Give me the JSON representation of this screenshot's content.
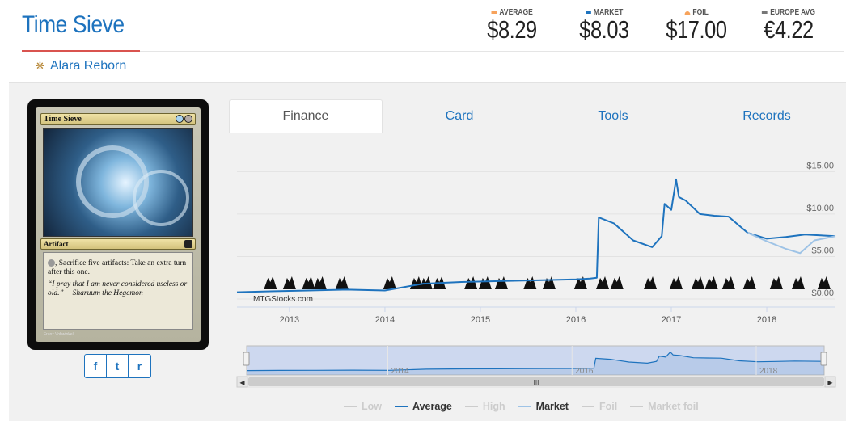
{
  "header": {
    "title": "Time Sieve",
    "set_name": "Alara Reborn"
  },
  "prices": [
    {
      "label": "AVERAGE",
      "value": "$8.29",
      "color": "#f7a35c"
    },
    {
      "label": "MARKET",
      "value": "$8.03",
      "color": "#1e73be"
    },
    {
      "label": "FOIL",
      "value": "$17.00",
      "color": "#f7a35c"
    },
    {
      "label": "EUROPE AVG",
      "value": "€4.22",
      "color": "#777777"
    }
  ],
  "card": {
    "name": "Time Sieve",
    "type_line": "Artifact",
    "rules_text": ", Sacrifice five artifacts: Take an extra turn after this one.",
    "flavor_text": "“I pray that I am never considered useless or old.” —Sharuum the Hegemon",
    "artist": "Franz Vohwinkel"
  },
  "share": {
    "facebook": "f",
    "twitter": "t",
    "reddit": "r"
  },
  "tabs": [
    {
      "label": "Finance",
      "active": true
    },
    {
      "label": "Card",
      "active": false
    },
    {
      "label": "Tools",
      "active": false
    },
    {
      "label": "Records",
      "active": false
    }
  ],
  "chart_data": {
    "type": "line",
    "credit": "MTGStocks.com",
    "y_ticks": [
      "$15.00",
      "$10.00",
      "$5.00",
      "$0.00"
    ],
    "ylim": [
      0,
      15
    ],
    "x_ticks": [
      "2013",
      "2014",
      "2015",
      "2016",
      "2017",
      "2018"
    ],
    "xlim": [
      2012.45,
      2018.72
    ],
    "grid": true,
    "series": [
      {
        "name": "Average",
        "color": "#1e73be",
        "x": [
          2012.45,
          2012.8,
          2013.2,
          2013.6,
          2014.0,
          2014.4,
          2014.8,
          2015.2,
          2015.6,
          2016.0,
          2016.15,
          2016.22,
          2016.24,
          2016.4,
          2016.6,
          2016.8,
          2016.9,
          2016.93,
          2017.0,
          2017.05,
          2017.08,
          2017.15,
          2017.3,
          2017.45,
          2017.6,
          2017.8,
          2018.0,
          2018.2,
          2018.4,
          2018.72
        ],
        "values": [
          0.8,
          0.9,
          1.0,
          1.1,
          1.0,
          1.8,
          2.0,
          2.1,
          2.2,
          2.3,
          2.4,
          2.5,
          9.6,
          8.9,
          6.9,
          6.1,
          7.4,
          11.2,
          10.5,
          14.1,
          12.0,
          11.6,
          10.0,
          9.8,
          9.7,
          7.8,
          7.1,
          7.3,
          7.6,
          7.4
        ]
      },
      {
        "name": "Market",
        "color": "#9ec3e6",
        "x": [
          2017.8,
          2018.0,
          2018.2,
          2018.35,
          2018.5,
          2018.72
        ],
        "values": [
          7.8,
          6.8,
          5.9,
          5.4,
          6.9,
          7.4
        ]
      }
    ],
    "legend": [
      {
        "name": "Low",
        "color": "#cccccc",
        "active": false
      },
      {
        "name": "Average",
        "color": "#1e73be",
        "active": true
      },
      {
        "name": "High",
        "color": "#cccccc",
        "active": false
      },
      {
        "name": "Market",
        "color": "#9ec3e6",
        "active": true
      },
      {
        "name": "Foil",
        "color": "#cccccc",
        "active": false
      },
      {
        "name": "Market foil",
        "color": "#cccccc",
        "active": false
      }
    ],
    "navigator": {
      "x_ticks": [
        "2014",
        "2016",
        "2018"
      ],
      "scrollbar_grip": "III",
      "left_arrow": "◀",
      "right_arrow": "▶"
    }
  }
}
